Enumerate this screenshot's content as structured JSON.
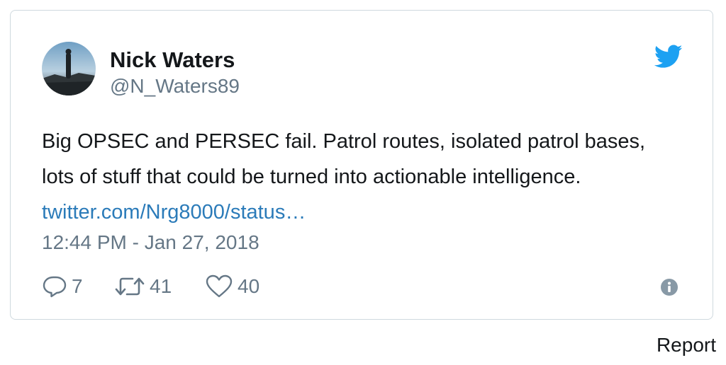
{
  "author": {
    "display_name": "Nick Waters",
    "handle": "@N_Waters89"
  },
  "tweet": {
    "text": "Big OPSEC and PERSEC fail. Patrol routes, isolated patrol bases, lots of stuff that could be turned into actionable intelligence. ",
    "link_text": "twitter.com/Nrg8000/status…",
    "timestamp": "12:44 PM - Jan 27, 2018"
  },
  "actions": {
    "reply_count": "7",
    "retweet_count": "41",
    "like_count": "40"
  },
  "footer": {
    "report_label": "Report"
  },
  "icons": {
    "bird": "twitter-bird-icon",
    "reply": "reply-icon",
    "retweet": "retweet-icon",
    "like": "heart-icon",
    "info": "info-icon"
  },
  "colors": {
    "brand": "#1da1f2",
    "link": "#2b7bb9",
    "muted": "#657786",
    "text": "#14171a",
    "border": "#cfd9de"
  }
}
